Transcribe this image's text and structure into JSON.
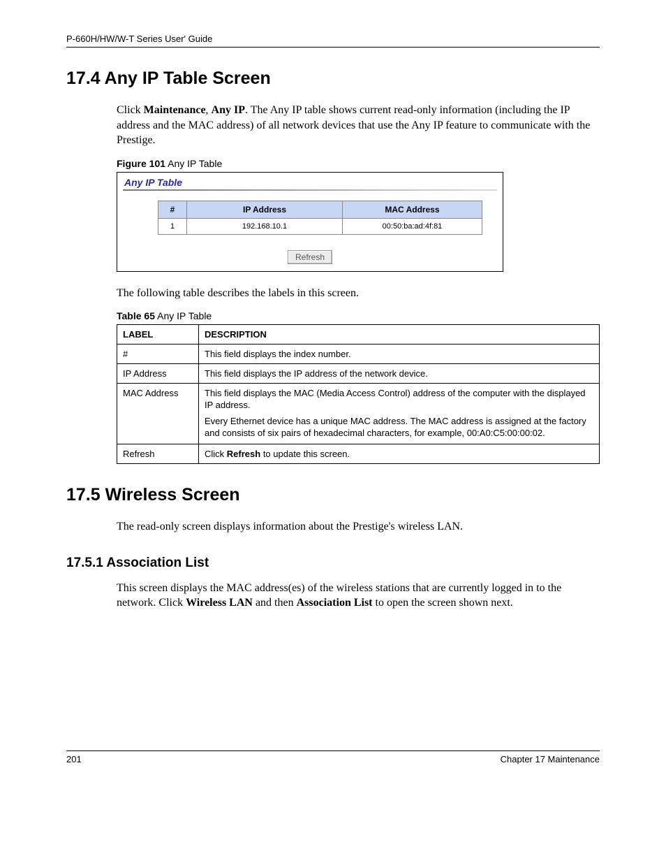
{
  "header": {
    "guide_title": "P-660H/HW/W-T Series User' Guide"
  },
  "section_17_4": {
    "heading": "17.4  Any IP Table Screen",
    "intro_segments": {
      "s1": "Click ",
      "b1": "Maintenance",
      "s2": ", ",
      "b2": "Any IP",
      "s3": ". The Any IP table shows current read-only information (including the IP address and the MAC address) of all network devices that use the Any IP feature to communicate with the Prestige."
    },
    "figure": {
      "label": "Figure 101",
      "caption": "   Any IP Table",
      "screenshot_title": "Any IP Table",
      "columns": {
        "c1": "#",
        "c2": "IP Address",
        "c3": "MAC Address"
      },
      "rows": [
        {
          "num": "1",
          "ip": "192.168.10.1",
          "mac": "00:50:ba:ad:4f:81"
        }
      ],
      "refresh_label": "Refresh"
    },
    "after_figure": "The following table describes the labels in this screen.",
    "table65": {
      "label": "Table 65",
      "caption": "   Any IP Table",
      "head": {
        "h1": "LABEL",
        "h2": "DESCRIPTION"
      },
      "rows": {
        "r1_label": "#",
        "r1_desc": "This field displays the index number.",
        "r2_label": "IP Address",
        "r2_desc": "This field displays the IP address of the network device.",
        "r3_label": "MAC Address",
        "r3_desc_p1": "This field displays the MAC (Media Access Control) address of the computer with the displayed IP address.",
        "r3_desc_p2": "Every Ethernet device has a unique MAC address. The MAC address is assigned at the factory and consists of six pairs of hexadecimal characters, for example, 00:A0:C5:00:00:02.",
        "r4_label": "Refresh",
        "r4_desc_s1": "Click ",
        "r4_desc_b": "Refresh",
        "r4_desc_s2": " to update this screen."
      }
    }
  },
  "section_17_5": {
    "heading": "17.5  Wireless Screen",
    "intro": "The read-only screen displays information about the Prestige's wireless LAN.",
    "sub": {
      "heading": "17.5.1  Association List",
      "para_segments": {
        "s1": "This screen displays the MAC address(es) of the wireless stations that are currently logged in to the network. Click ",
        "b1": "Wireless LAN",
        "s2": " and then ",
        "b2": "Association List",
        "s3": " to open the screen shown next."
      }
    }
  },
  "footer": {
    "page": "201",
    "chapter": "Chapter 17 Maintenance"
  }
}
